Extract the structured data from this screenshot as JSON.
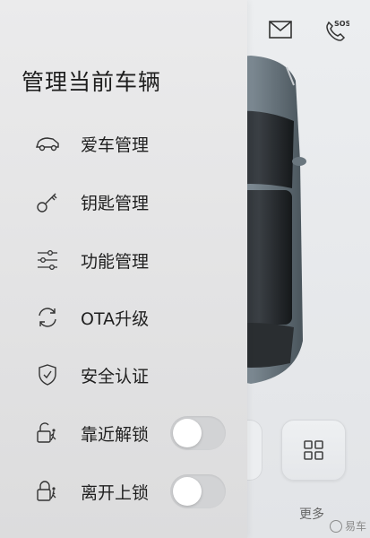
{
  "background": {
    "top_icons": [
      "mail-icon",
      "sos-phone-icon"
    ],
    "sos_text": "SOS",
    "more_label": "更多",
    "grid_icon": "grid-icon",
    "watermark": "易车"
  },
  "drawer": {
    "title": "管理当前车辆",
    "items": [
      {
        "label": "爱车管理",
        "icon": "car-icon"
      },
      {
        "label": "钥匙管理",
        "icon": "key-icon"
      },
      {
        "label": "功能管理",
        "icon": "sliders-icon"
      },
      {
        "label": "OTA升级",
        "icon": "refresh-icon"
      },
      {
        "label": "安全认证",
        "icon": "shield-check-icon"
      },
      {
        "label": "靠近解锁",
        "icon": "unlock-icon",
        "toggle": false
      },
      {
        "label": "离开上锁",
        "icon": "lock-icon",
        "toggle": false
      }
    ]
  }
}
